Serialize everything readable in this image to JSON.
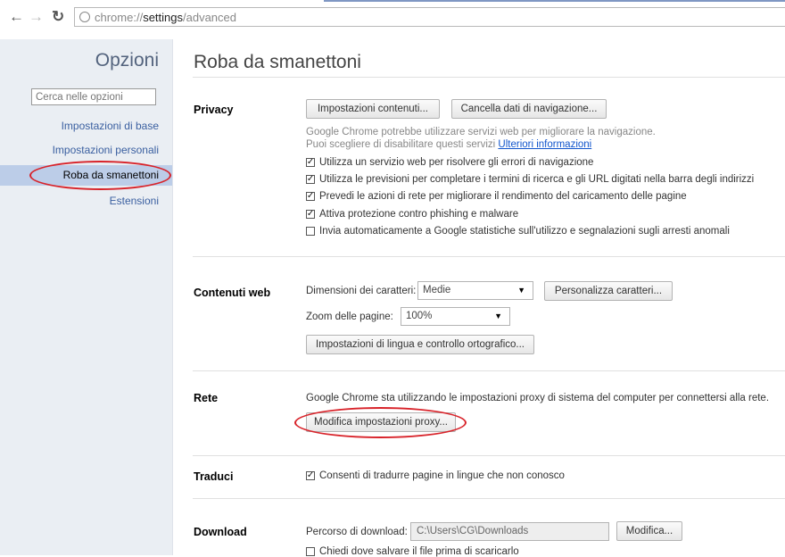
{
  "browser": {
    "back_icon": "arrow-left-icon",
    "forward_icon": "arrow-right-icon",
    "reload_icon": "reload-icon",
    "url_scheme": "chrome://",
    "url_host": "settings",
    "url_path": "/advanced"
  },
  "sidebar": {
    "title": "Opzioni",
    "search_placeholder": "Cerca nelle opzioni",
    "items": [
      {
        "label": "Impostazioni di base"
      },
      {
        "label": "Impostazioni personali"
      },
      {
        "label": "Roba da smanettoni"
      },
      {
        "label": "Estensioni"
      }
    ]
  },
  "page": {
    "title": "Roba da smanettoni"
  },
  "privacy": {
    "heading": "Privacy",
    "btn_content": "Impostazioni contenuti...",
    "btn_clear": "Cancella dati di navigazione...",
    "desc1": "Google Chrome potrebbe utilizzare servizi web per migliorare la navigazione.",
    "desc2": "Puoi scegliere di disabilitare questi servizi",
    "more_link": "Ulteriori informazioni",
    "checkboxes": [
      {
        "label": "Utilizza un servizio web per risolvere gli errori di navigazione",
        "checked": true
      },
      {
        "label": "Utilizza le previsioni per completare i termini di ricerca e gli URL digitati nella barra degli indirizzi",
        "checked": true
      },
      {
        "label": "Prevedi le azioni di rete per migliorare il rendimento del caricamento delle pagine",
        "checked": true
      },
      {
        "label": "Attiva protezione contro phishing e malware",
        "checked": true
      },
      {
        "label": "Invia automaticamente a Google statistiche sull'utilizzo e segnalazioni sugli arresti anomali",
        "checked": false
      }
    ]
  },
  "web_content": {
    "heading": "Contenuti web",
    "font_size_label": "Dimensioni dei caratteri:",
    "font_size_value": "Medie",
    "customize_fonts": "Personalizza caratteri...",
    "zoom_label": "Zoom delle pagine:",
    "zoom_value": "100%",
    "language_btn": "Impostazioni di lingua e controllo ortografico..."
  },
  "network": {
    "heading": "Rete",
    "desc": "Google Chrome sta utilizzando le impostazioni proxy di sistema del computer per connettersi alla rete.",
    "proxy_btn": "Modifica impostazioni proxy..."
  },
  "translate": {
    "heading": "Traduci",
    "checkbox": "Consenti di tradurre pagine in lingue che non conosco",
    "checked": true
  },
  "downloads": {
    "heading": "Download",
    "path_label": "Percorso di download:",
    "path_value": "C:\\Users\\CG\\Downloads",
    "change_btn": "Modifica...",
    "ask_checkbox": "Chiedi dove salvare il file prima di scaricarlo",
    "ask_checked": false
  },
  "colors": {
    "highlight_oval": "#d8232a",
    "sidebar_bg": "#eaeef3",
    "active_item_bg": "#bccde8",
    "link": "#1155cc"
  }
}
